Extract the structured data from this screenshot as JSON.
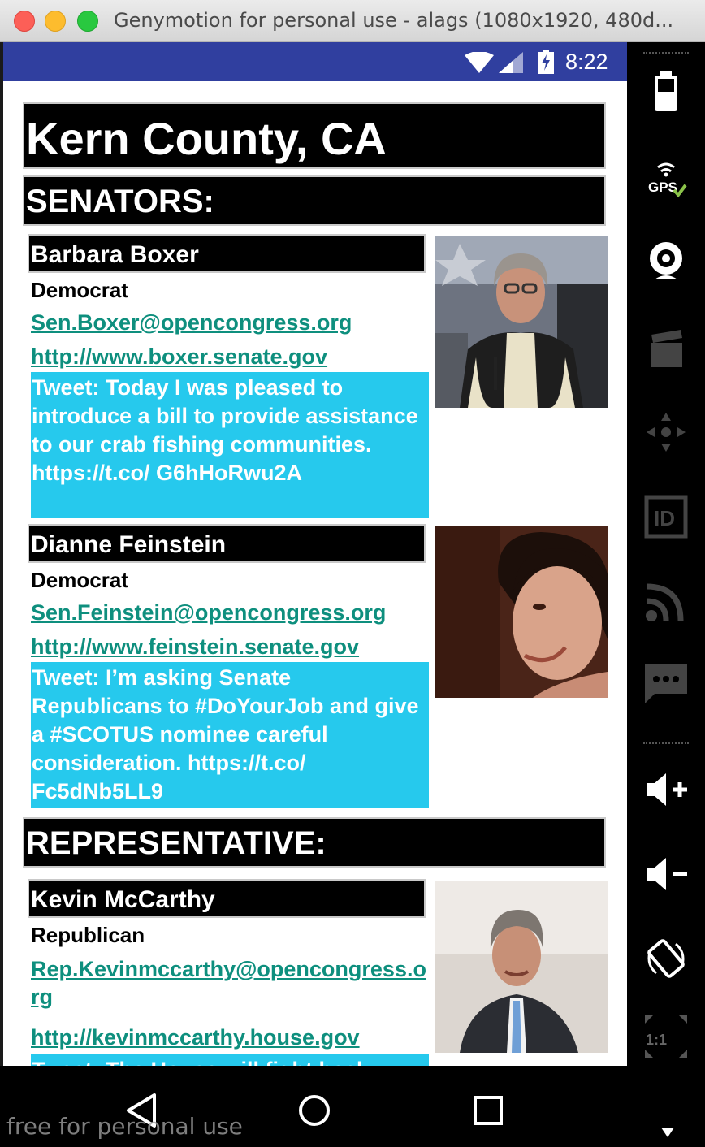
{
  "window": {
    "title": "Genymotion for personal use - alags (1080x1920, 480d..."
  },
  "status_bar": {
    "time": "8:22",
    "icons": [
      "wifi-icon",
      "signal-icon",
      "battery-charging-icon"
    ]
  },
  "page": {
    "county_title": "Kern County, CA",
    "senators_header": "SENATORS:",
    "representative_header": "REPRESENTATIVE:"
  },
  "senators": [
    {
      "name": "Barbara Boxer",
      "party": "Democrat",
      "email": "Sen.Boxer@opencongress.org",
      "website": "http://www.boxer.senate.gov",
      "tweet": "Tweet: Today I was pleased to introduce a bill to provide assistance to our crab fishing communities. https://t.co/ G6hHoRwu2A"
    },
    {
      "name": "Dianne Feinstein",
      "party": "Democrat",
      "email": "Sen.Feinstein@opencongress.org",
      "website": "http://www.feinstein.senate.gov",
      "tweet": "Tweet: I’m asking Senate Republicans to #DoYourJob and give a #SCOTUS nominee careful consideration. https://t.co/ Fc5dNb5LL9"
    }
  ],
  "representatives": [
    {
      "name": "Kevin McCarthy",
      "party": "Republican",
      "email": "Rep.Kevinmccarthy@opencongress.org",
      "website": "http://kevinmccarthy.house.gov",
      "tweet": "Tweet: The House will fight back"
    }
  ],
  "toolbar": {
    "tools": [
      "battery-icon",
      "gps-icon",
      "webcam-icon",
      "media-icon",
      "dpad-icon",
      "id-icon",
      "cast-icon",
      "sms-icon",
      "volume-up-icon",
      "volume-down-icon",
      "rotate-icon",
      "scale-icon"
    ],
    "scale_label": "1:1"
  },
  "nav_bar": {
    "buttons": [
      "back-icon",
      "home-icon",
      "recents-icon"
    ],
    "watermark": "free for personal use"
  },
  "colors": {
    "status_bar": "#303f9f",
    "tweet_bg": "#26c9ed",
    "link": "#0e8f7e",
    "header_bg": "#000000"
  }
}
